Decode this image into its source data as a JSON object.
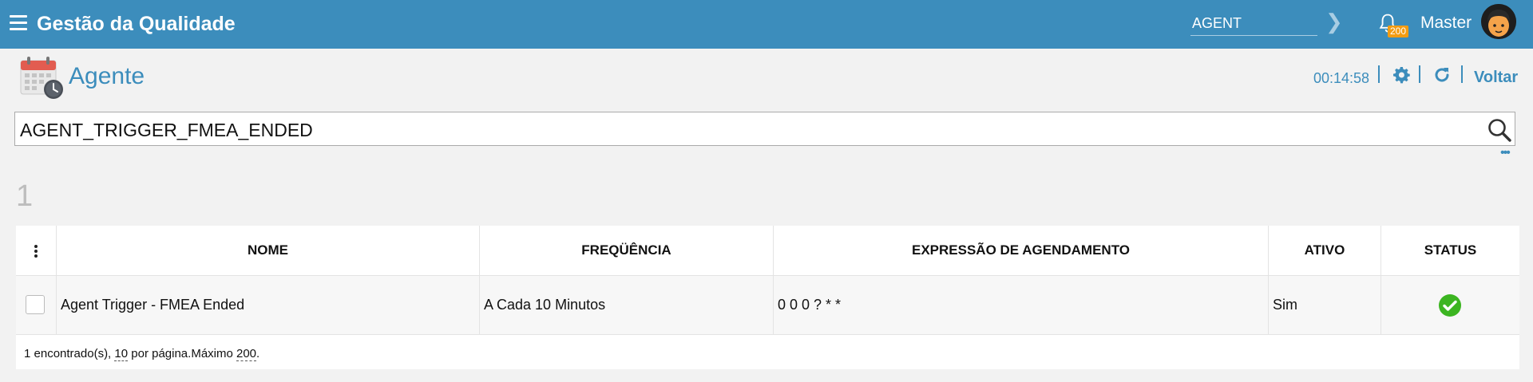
{
  "header": {
    "app_title": "Gestão da Qualidade",
    "search_value": "AGENT",
    "notification_count": "200",
    "user_name": "Master",
    "brand_color": "#3c8dbc"
  },
  "page": {
    "title": "Agente",
    "timer": "00:14:58",
    "back_label": "Voltar"
  },
  "search": {
    "value": "AGENT_TRIGGER_FMEA_ENDED"
  },
  "results": {
    "count": "1"
  },
  "table": {
    "columns": [
      "NOME",
      "FREQÜÊNCIA",
      "EXPRESSÃO DE AGENDAMENTO",
      "ATIVO",
      "STATUS"
    ],
    "rows": [
      {
        "nome": "Agent Trigger - FMEA Ended",
        "frequencia": "A Cada 10 Minutos",
        "expressao": "0 0 0 ? * *",
        "ativo": "Sim",
        "status_icon": "check-circle-icon",
        "status_color": "#3cb521"
      }
    ],
    "footer": {
      "found_text": "1 encontrado(s), ",
      "per_page": "10",
      "per_page_text": " por página.Máximo ",
      "max": "200",
      "end": "."
    }
  }
}
